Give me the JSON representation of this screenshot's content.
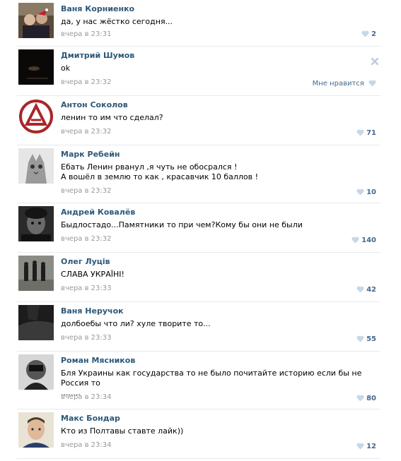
{
  "comments": [
    {
      "author": "Ваня Корниенко",
      "text": "да, у нас жёстко сегодня...",
      "time": "вчера в 23:31",
      "likes": "2"
    },
    {
      "author": "Дмитрий Шумов",
      "text": "ok",
      "time": "вчера в 23:32",
      "like_label": "Мне нравится"
    },
    {
      "author": "Антон Соколов",
      "text": "ленин то им что сделал?",
      "time": "вчера в 23:32",
      "likes": "71"
    },
    {
      "author": "Марк Ребейн",
      "text_line1": "Ебать Ленин рванул ,я чуть не обосрался !",
      "text_line2": "А вошёл в землю то как , красавчик 10 баллов !",
      "time": "вчера в 23:32",
      "likes": "10"
    },
    {
      "author": "Андрей Ковалёв",
      "text": "Быдлостадо...Памятники то при чем?Кому бы они не были",
      "time": "вчера в 23:32",
      "likes": "140"
    },
    {
      "author": "Олег Луців",
      "text": "СЛАВА УКРАЇНІ!",
      "time": "вчера в 23:33",
      "likes": "42"
    },
    {
      "author": "Ваня Неручок",
      "text": "долбоебы что ли? хуле творите то...",
      "time": "вчера в 23:33",
      "likes": "55"
    },
    {
      "author": "Роман Мясников",
      "text_line1": "Бля Украины как государства то не было почитайте историю если бы не Россия то",
      "text_line2": "........",
      "time": "вчера в 23:34",
      "likes": "80"
    },
    {
      "author": "Макс Бондар",
      "text": "Кто из Полтавы ставте лайк))",
      "time": "вчера в 23:34",
      "likes": "12"
    }
  ],
  "colors": {
    "author": "#2b587a",
    "time": "#999999",
    "likes": "#45688e",
    "heart": "#c7d7e6",
    "divider": "#e7eaed"
  }
}
